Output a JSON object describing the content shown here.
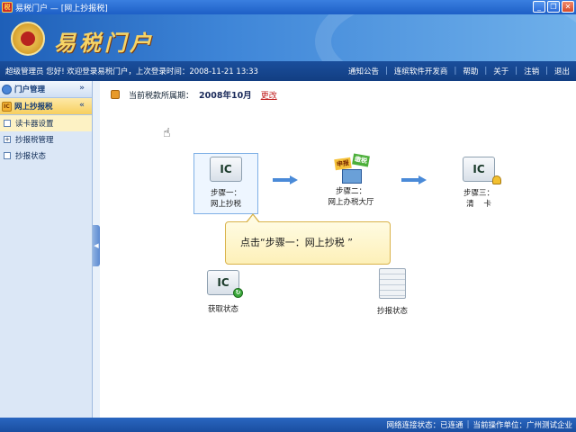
{
  "window": {
    "title": "易税门户  —  [网上抄报税]",
    "icon_text": "税",
    "controls": [
      "_",
      "❐",
      "✕"
    ]
  },
  "banner": {
    "title": "易税门户"
  },
  "infobar": {
    "welcome": "超级管理员  您好! 欢迎登录易税门户，上次登录时间：2008-11-21 13:33",
    "nav": [
      "通知公告",
      "连缤软件开发商",
      "帮助",
      "关于",
      "注销",
      "退出"
    ]
  },
  "sidebar": {
    "sections": [
      {
        "label": "门户管理",
        "arrow": "»"
      },
      {
        "label": "网上抄报税",
        "arrow": "«"
      }
    ],
    "items": [
      {
        "label": "读卡器设置",
        "marker": ""
      },
      {
        "label": "抄报税管理",
        "marker": "+"
      },
      {
        "label": "抄报状态",
        "marker": ""
      }
    ],
    "collapse_glyph": "◀"
  },
  "main": {
    "period_label": "当前税款所属期：",
    "period_value": "2008年10月",
    "period_change": "更改",
    "steps": [
      {
        "icon": "IC",
        "line1": "步骤一：",
        "line2": "网上抄税"
      },
      {
        "icon": "",
        "line1": "步骤二：",
        "line2": "网上办税大厅",
        "tag1": "申报",
        "tag2": "缴税"
      },
      {
        "icon": "IC",
        "line1": "步骤三：",
        "line2": "清    卡"
      }
    ],
    "tooltip": "点击“步骤一：网上抄税 ”",
    "extras": [
      {
        "icon": "IC",
        "label": "获取状态"
      },
      {
        "label": "抄报状态"
      }
    ]
  },
  "statusbar": {
    "connection": "网络连接状态：已连通",
    "unit": "当前操作单位：广州测试企业"
  }
}
